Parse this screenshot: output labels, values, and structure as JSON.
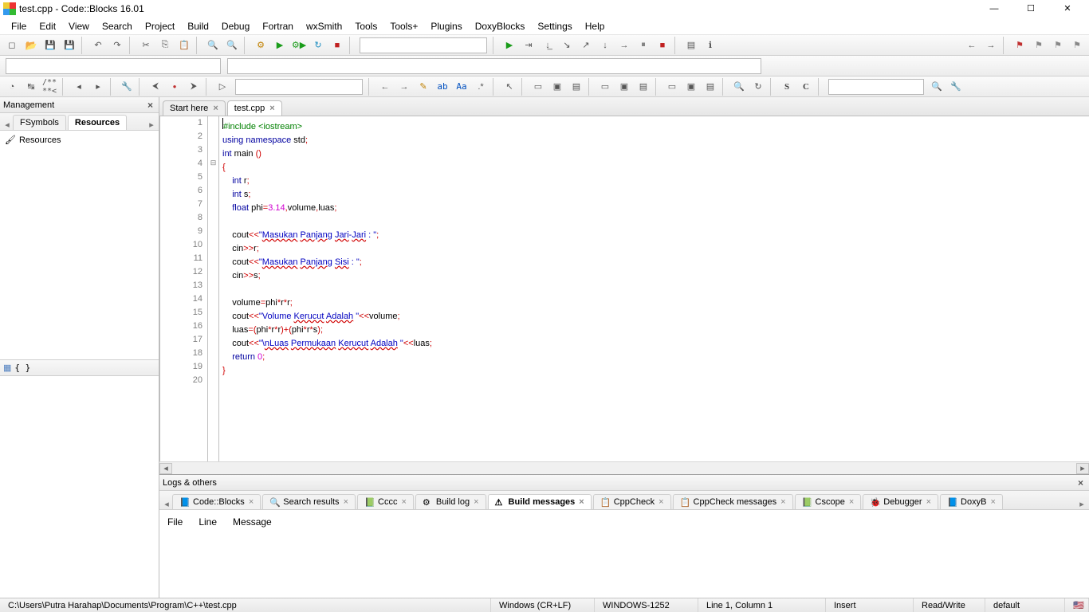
{
  "title": "test.cpp - Code::Blocks 16.01",
  "menu": [
    "File",
    "Edit",
    "View",
    "Search",
    "Project",
    "Build",
    "Debug",
    "Fortran",
    "wxSmith",
    "Tools",
    "Tools+",
    "Plugins",
    "DoxyBlocks",
    "Settings",
    "Help"
  ],
  "management": {
    "title": "Management",
    "tabs": [
      "FSymbols",
      "Resources"
    ],
    "active_tab": "Resources",
    "tree_root": "Resources",
    "bottom_symbol": "{ }"
  },
  "editor_tabs": [
    {
      "label": "Start here",
      "active": false
    },
    {
      "label": "test.cpp",
      "active": true
    }
  ],
  "code_lines": [
    {
      "n": 1,
      "tokens": [
        {
          "t": "#include <iostream>",
          "c": "pp"
        }
      ]
    },
    {
      "n": 2,
      "tokens": [
        {
          "t": "using",
          "c": "k"
        },
        {
          "t": " "
        },
        {
          "t": "namespace",
          "c": "k"
        },
        {
          "t": " std"
        },
        {
          "t": ";",
          "c": "sym"
        }
      ]
    },
    {
      "n": 3,
      "tokens": [
        {
          "t": "int",
          "c": "k"
        },
        {
          "t": " main "
        },
        {
          "t": "()",
          "c": "sym"
        }
      ]
    },
    {
      "n": 4,
      "fold": "⊟",
      "tokens": [
        {
          "t": "{",
          "c": "sym"
        }
      ]
    },
    {
      "n": 5,
      "indent": 1,
      "tokens": [
        {
          "t": "int",
          "c": "k"
        },
        {
          "t": " r"
        },
        {
          "t": ";",
          "c": "sym"
        }
      ]
    },
    {
      "n": 6,
      "indent": 1,
      "tokens": [
        {
          "t": "int",
          "c": "k"
        },
        {
          "t": " s"
        },
        {
          "t": ";",
          "c": "sym"
        }
      ]
    },
    {
      "n": 7,
      "indent": 1,
      "tokens": [
        {
          "t": "float",
          "c": "k"
        },
        {
          "t": " phi"
        },
        {
          "t": "=",
          "c": "sym"
        },
        {
          "t": "3.14",
          "c": "n"
        },
        {
          "t": ",",
          "c": "sym"
        },
        {
          "t": "volume"
        },
        {
          "t": ",",
          "c": "sym"
        },
        {
          "t": "luas"
        },
        {
          "t": ";",
          "c": "sym"
        }
      ]
    },
    {
      "n": 8,
      "tokens": []
    },
    {
      "n": 9,
      "indent": 1,
      "tokens": [
        {
          "t": "cout"
        },
        {
          "t": "<<",
          "c": "sym"
        },
        {
          "t": "\"",
          "c": "s"
        },
        {
          "t": "Masukan",
          "c": "s",
          "w": true
        },
        {
          "t": " ",
          "c": "s"
        },
        {
          "t": "Panjang",
          "c": "s",
          "w": true
        },
        {
          "t": " ",
          "c": "s"
        },
        {
          "t": "Jari",
          "c": "s",
          "w": true
        },
        {
          "t": "-",
          "c": "s"
        },
        {
          "t": "Jari",
          "c": "s",
          "w": true
        },
        {
          "t": " : \"",
          "c": "s"
        },
        {
          "t": ";",
          "c": "sym"
        }
      ]
    },
    {
      "n": 10,
      "indent": 1,
      "tokens": [
        {
          "t": "cin"
        },
        {
          "t": ">>",
          "c": "sym"
        },
        {
          "t": "r"
        },
        {
          "t": ";",
          "c": "sym"
        }
      ]
    },
    {
      "n": 11,
      "indent": 1,
      "tokens": [
        {
          "t": "cout"
        },
        {
          "t": "<<",
          "c": "sym"
        },
        {
          "t": "\"",
          "c": "s"
        },
        {
          "t": "Masukan",
          "c": "s",
          "w": true
        },
        {
          "t": " ",
          "c": "s"
        },
        {
          "t": "Panjang",
          "c": "s",
          "w": true
        },
        {
          "t": " ",
          "c": "s"
        },
        {
          "t": "Sisi",
          "c": "s",
          "w": true
        },
        {
          "t": " : \"",
          "c": "s"
        },
        {
          "t": ";",
          "c": "sym"
        }
      ]
    },
    {
      "n": 12,
      "indent": 1,
      "tokens": [
        {
          "t": "cin"
        },
        {
          "t": ">>",
          "c": "sym"
        },
        {
          "t": "s"
        },
        {
          "t": ";",
          "c": "sym"
        }
      ]
    },
    {
      "n": 13,
      "tokens": []
    },
    {
      "n": 14,
      "indent": 1,
      "tokens": [
        {
          "t": "volume"
        },
        {
          "t": "=",
          "c": "sym"
        },
        {
          "t": "phi"
        },
        {
          "t": "*",
          "c": "sym"
        },
        {
          "t": "r"
        },
        {
          "t": "*",
          "c": "sym"
        },
        {
          "t": "r"
        },
        {
          "t": ";",
          "c": "sym"
        }
      ]
    },
    {
      "n": 15,
      "indent": 1,
      "tokens": [
        {
          "t": "cout"
        },
        {
          "t": "<<",
          "c": "sym"
        },
        {
          "t": "\"Volume ",
          "c": "s"
        },
        {
          "t": "Kerucut",
          "c": "s",
          "w": true
        },
        {
          "t": " ",
          "c": "s"
        },
        {
          "t": "Adalah",
          "c": "s",
          "w": true
        },
        {
          "t": " \"",
          "c": "s"
        },
        {
          "t": "<<",
          "c": "sym"
        },
        {
          "t": "volume"
        },
        {
          "t": ";",
          "c": "sym"
        }
      ]
    },
    {
      "n": 16,
      "indent": 1,
      "tokens": [
        {
          "t": "luas"
        },
        {
          "t": "=(",
          "c": "sym"
        },
        {
          "t": "phi"
        },
        {
          "t": "*",
          "c": "sym"
        },
        {
          "t": "r"
        },
        {
          "t": "*",
          "c": "sym"
        },
        {
          "t": "r"
        },
        {
          "t": ")+(",
          "c": "sym"
        },
        {
          "t": "phi"
        },
        {
          "t": "*",
          "c": "sym"
        },
        {
          "t": "r"
        },
        {
          "t": "*",
          "c": "sym"
        },
        {
          "t": "s"
        },
        {
          "t": ");",
          "c": "sym"
        }
      ]
    },
    {
      "n": 17,
      "indent": 1,
      "tokens": [
        {
          "t": "cout"
        },
        {
          "t": "<<",
          "c": "sym"
        },
        {
          "t": "\"\\",
          "c": "s"
        },
        {
          "t": "nLuas",
          "c": "s",
          "w": true
        },
        {
          "t": " ",
          "c": "s"
        },
        {
          "t": "Permukaan",
          "c": "s",
          "w": true
        },
        {
          "t": " ",
          "c": "s"
        },
        {
          "t": "Kerucut",
          "c": "s",
          "w": true
        },
        {
          "t": " ",
          "c": "s"
        },
        {
          "t": "Adalah",
          "c": "s",
          "w": true
        },
        {
          "t": " \"",
          "c": "s"
        },
        {
          "t": "<<",
          "c": "sym"
        },
        {
          "t": "luas"
        },
        {
          "t": ";",
          "c": "sym"
        }
      ]
    },
    {
      "n": 18,
      "indent": 1,
      "tokens": [
        {
          "t": "return",
          "c": "k"
        },
        {
          "t": " "
        },
        {
          "t": "0",
          "c": "n"
        },
        {
          "t": ";",
          "c": "sym"
        }
      ]
    },
    {
      "n": 19,
      "tokens": [
        {
          "t": "}",
          "c": "sym"
        }
      ]
    },
    {
      "n": 20,
      "tokens": []
    }
  ],
  "logs": {
    "title": "Logs & others",
    "tabs": [
      "Code::Blocks",
      "Search results",
      "Cccc",
      "Build log",
      "Build messages",
      "CppCheck",
      "CppCheck messages",
      "Cscope",
      "Debugger",
      "DoxyB"
    ],
    "active": "Build messages",
    "columns": [
      "File",
      "Line",
      "Message"
    ]
  },
  "status": {
    "path": "C:\\Users\\Putra Harahap\\Documents\\Program\\C++\\test.cpp",
    "eol": "Windows (CR+LF)",
    "enc": "WINDOWS-1252",
    "pos": "Line 1, Column 1",
    "ins": "Insert",
    "rw": "Read/Write",
    "def": "default"
  },
  "toolbar_comment": "/** **<"
}
